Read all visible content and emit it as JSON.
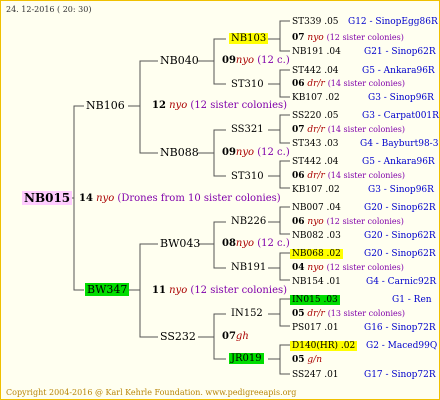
{
  "header_date": "24. 12-2016 ( 20: 30)",
  "footer": "Copyright 2004-2016 @ Karl Kehrle Foundation.   www.pedigreeapis.org",
  "root": {
    "name": "NB015",
    "gen": "14",
    "info": "(Drones from 10 sister colonies)"
  },
  "sire": {
    "name": "NB106",
    "gen": "12",
    "info": "(12 sister colonies)"
  },
  "dam": {
    "name": "BW347",
    "gen": "11",
    "info": "(12 sister colonies)"
  },
  "ss": {
    "name": "NB040",
    "gen": "09",
    "info": "(12 c.)"
  },
  "sd": {
    "name": "NB088",
    "gen": "09",
    "info": "(12 c.)"
  },
  "ds": {
    "name": "BW043",
    "gen": "08",
    "info": "(12 c.)"
  },
  "dd": {
    "name": "SS232",
    "gen": "07"
  },
  "sss": {
    "name": "NB103"
  },
  "ssd": {
    "name": "ST310"
  },
  "sds": {
    "name": "SS321"
  },
  "sdd": {
    "name": "ST310"
  },
  "dss": {
    "name": "NB226"
  },
  "dsd": {
    "name": "NB191"
  },
  "dds": {
    "name": "IN152"
  },
  "ddd": {
    "name": "JR019"
  },
  "leaves": [
    {
      "a": "ST339 .05",
      "b": "G12 - SinopEgg86R",
      "gen": "07",
      "info": "(12 sister colonies)",
      "c": "NB191 .04",
      "d": "G21 - Sinop62R"
    },
    {
      "a": "ST442 .04",
      "b": "G5 - Ankara96R",
      "gen": "06",
      "info": "(14 sister colonies)",
      "c": "KB107 .02",
      "d": "G3 - Sinop96R"
    },
    {
      "a": "SS220 .05",
      "b": "G3 - Carpat001R",
      "gen": "07",
      "info": "(14 sister colonies)",
      "c": "ST343 .03",
      "d": "G4 - Bayburt98-3"
    },
    {
      "a": "ST442 .04",
      "b": "G5 - Ankara96R",
      "gen": "06",
      "info": "(14 sister colonies)",
      "c": "KB107 .02",
      "d": "G3 - Sinop96R"
    },
    {
      "a": "NB007 .04",
      "b": "G20 - Sinop62R",
      "gen": "06",
      "info": "(12 sister colonies)",
      "c": "NB082 .03",
      "d": "G20 - Sinop62R"
    },
    {
      "a": "NB068 .02",
      "b": "G20 - Sinop62R",
      "gen": "04",
      "info": "(12 sister colonies)",
      "c": "NB154 .01",
      "d": "G4 - Carnic92R"
    },
    {
      "a": "IN015 .03",
      "b": "G1 - Ren",
      "gen": "05",
      "info": "(13 sister colonies)",
      "c": "PS017 .01",
      "d": "G16 - Sinop72R"
    },
    {
      "a": "D140(HR) .02",
      "b": "G2 - Maced99Q",
      "gen": "05",
      "info": "",
      "c": "SS247 .01",
      "d": "G17 - Sinop72R"
    }
  ]
}
